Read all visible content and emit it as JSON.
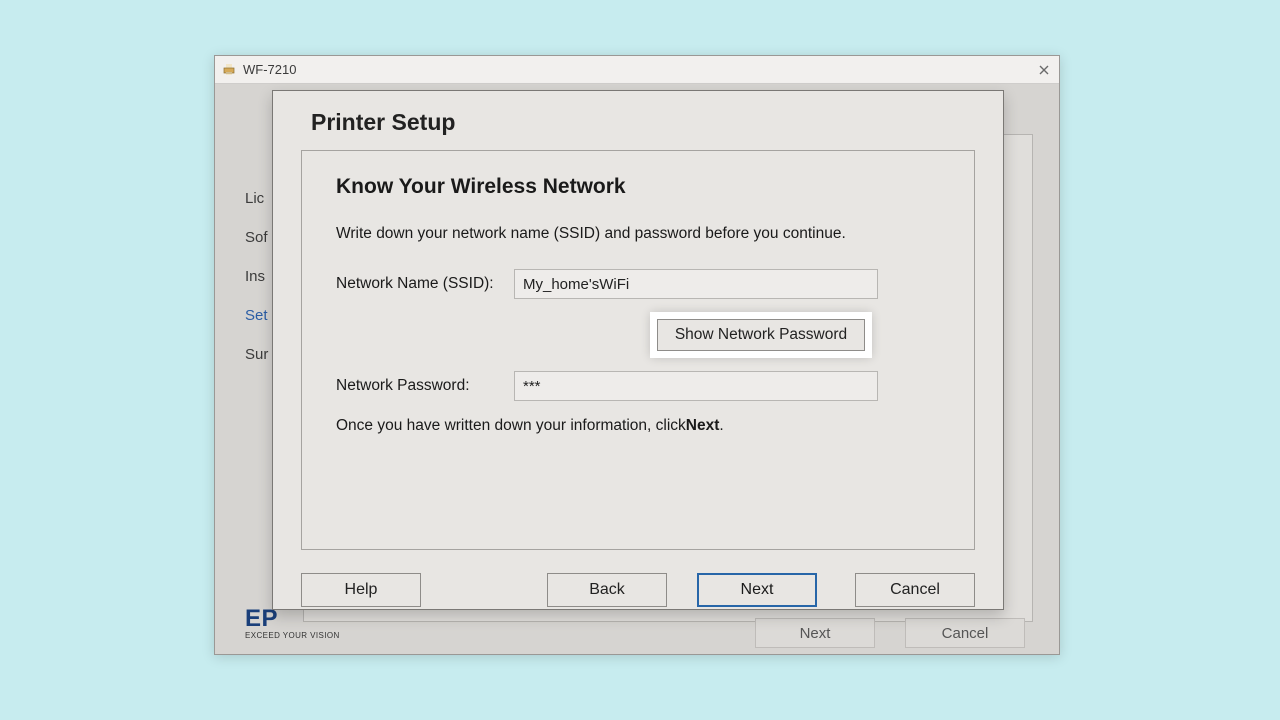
{
  "window": {
    "title": "WF-7210"
  },
  "sidebar": {
    "items": [
      {
        "label": "Lic"
      },
      {
        "label": "Sof"
      },
      {
        "label": "Ins"
      },
      {
        "label": "Set"
      },
      {
        "label": "Sur"
      }
    ]
  },
  "brand": {
    "logo": "EP",
    "tagline": "EXCEED YOUR VISION"
  },
  "outer_nav": {
    "next": "Next",
    "cancel": "Cancel"
  },
  "modal": {
    "heading": "Printer Setup",
    "subtitle": "Know Your Wireless Network",
    "instruction": "Write down your network name (SSID) and password before you continue.",
    "ssid_label": "Network Name (SSID):",
    "ssid_value": "My_home'sWiFi",
    "show_password_btn": "Show Network Password",
    "password_label": "Network Password:",
    "password_value": "***",
    "after1": "Once you have written down your information, click ",
    "after_bold": "Next",
    "after2": ".",
    "buttons": {
      "help": "Help",
      "back": "Back",
      "next": "Next",
      "cancel": "Cancel"
    }
  }
}
